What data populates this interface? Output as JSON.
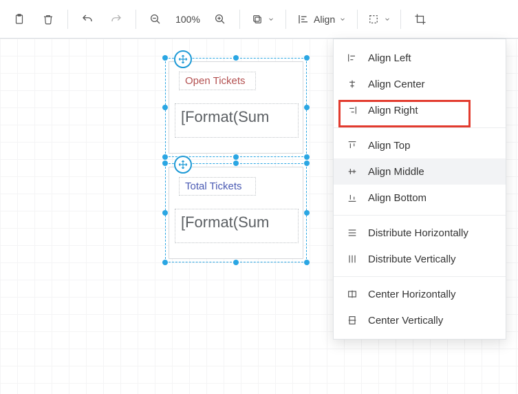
{
  "toolbar": {
    "zoom": "100%",
    "align_label": "Align"
  },
  "cards": [
    {
      "title": "Open Tickets",
      "value": "[Format(Sum"
    },
    {
      "title": "Total Tickets",
      "value": "[Format(Sum"
    }
  ],
  "menu": {
    "align_left": "Align Left",
    "align_center": "Align Center",
    "align_right": "Align Right",
    "align_top": "Align Top",
    "align_middle": "Align Middle",
    "align_bottom": "Align Bottom",
    "dist_h": "Distribute Horizontally",
    "dist_v": "Distribute Vertically",
    "center_h": "Center Horizontally",
    "center_v": "Center Vertically"
  }
}
